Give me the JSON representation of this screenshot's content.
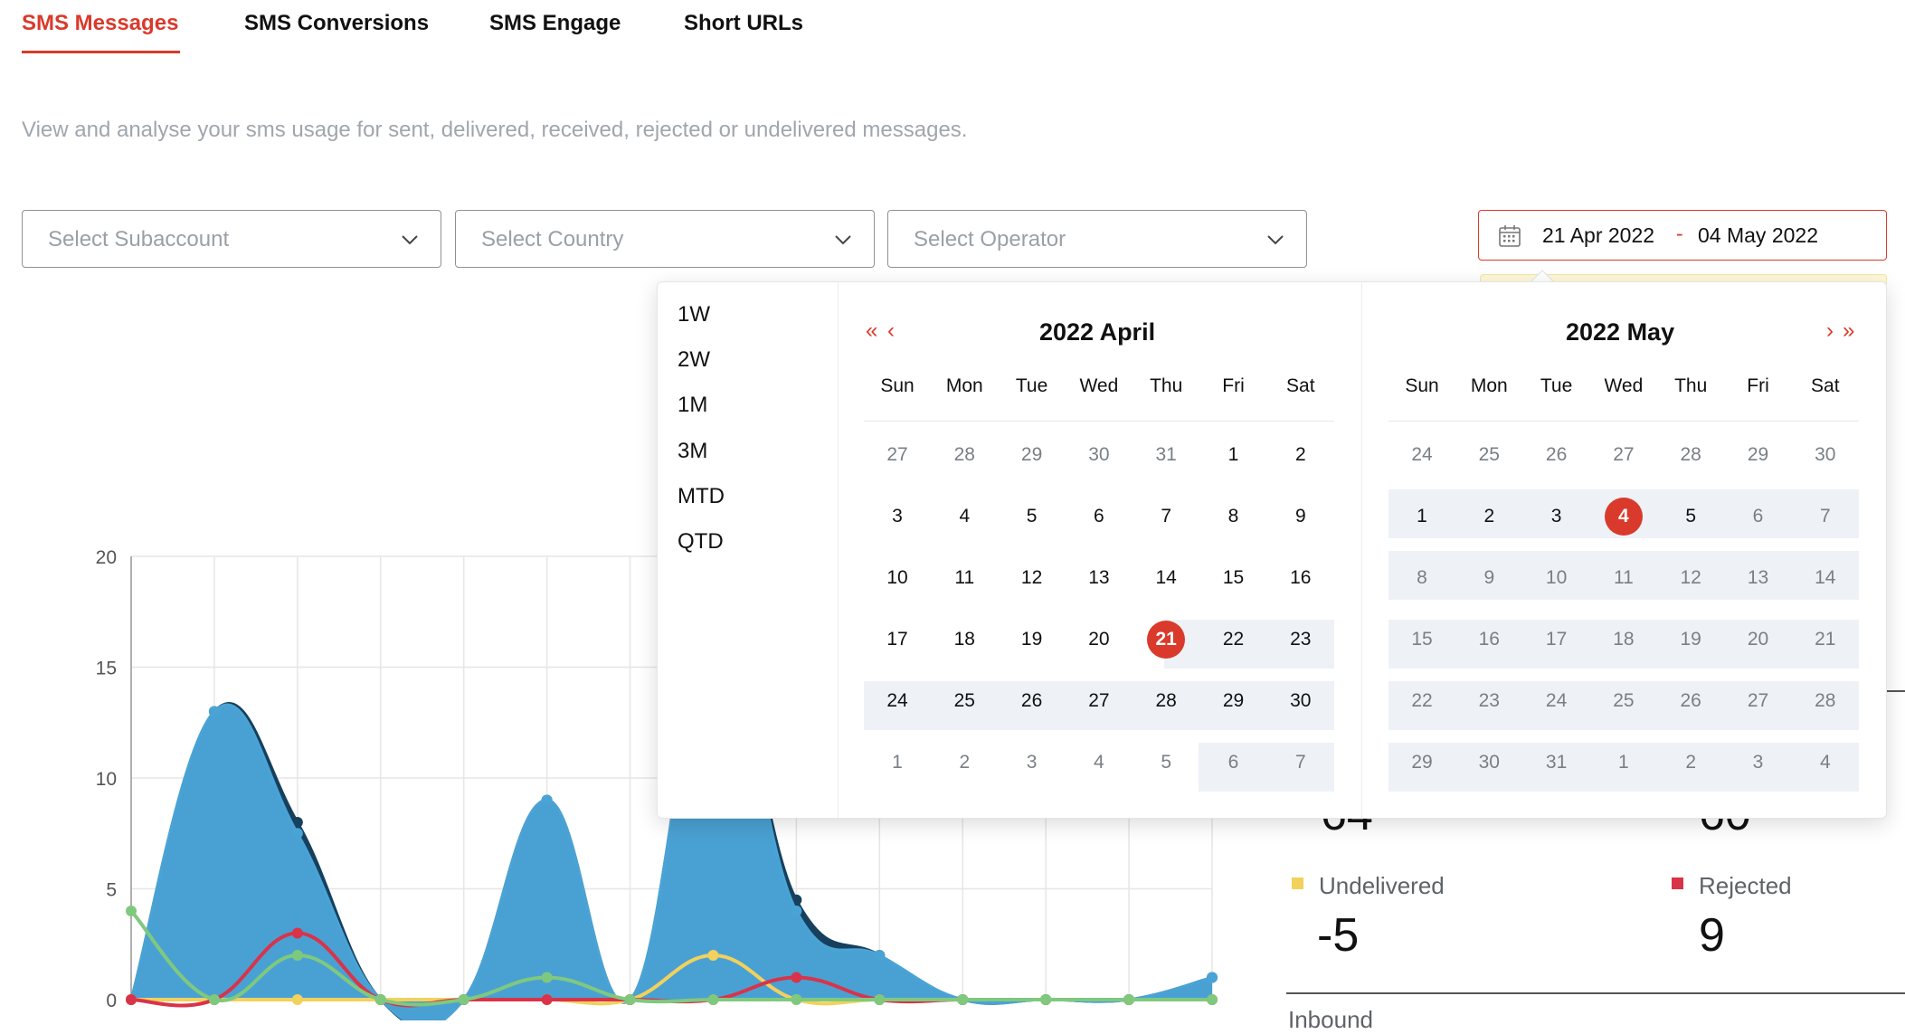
{
  "tabs": [
    {
      "label": "SMS Messages",
      "active": true
    },
    {
      "label": "SMS Conversions",
      "active": false
    },
    {
      "label": "SMS Engage",
      "active": false
    },
    {
      "label": "Short URLs",
      "active": false
    }
  ],
  "subtitle": "View and analyse your sms usage for sent, delivered, received, rejected or undelivered messages.",
  "filters": {
    "subaccount_placeholder": "Select Subaccount",
    "country_placeholder": "Select Country",
    "operator_placeholder": "Select Operator"
  },
  "date_range": {
    "start": "21 Apr 2022",
    "separator": "-",
    "end": "04 May 2022"
  },
  "picker": {
    "presets": [
      "1W",
      "2W",
      "1M",
      "3M",
      "MTD",
      "QTD"
    ],
    "weekdays": [
      "Sun",
      "Mon",
      "Tue",
      "Wed",
      "Thu",
      "Fri",
      "Sat"
    ],
    "left": {
      "title": "2022 April",
      "nav_prev_year": "«",
      "nav_prev_month": "‹",
      "weeks": [
        [
          "27",
          "28",
          "29",
          "30",
          "31",
          "1",
          "2"
        ],
        [
          "3",
          "4",
          "5",
          "6",
          "7",
          "8",
          "9"
        ],
        [
          "10",
          "11",
          "12",
          "13",
          "14",
          "15",
          "16"
        ],
        [
          "17",
          "18",
          "19",
          "20",
          "21",
          "22",
          "23"
        ],
        [
          "24",
          "25",
          "26",
          "27",
          "28",
          "29",
          "30"
        ],
        [
          "1",
          "2",
          "3",
          "4",
          "5",
          "6",
          "7"
        ]
      ]
    },
    "right": {
      "title": "2022 May",
      "nav_next_month": "›",
      "nav_next_year": "»",
      "weeks": [
        [
          "24",
          "25",
          "26",
          "27",
          "28",
          "29",
          "30"
        ],
        [
          "1",
          "2",
          "3",
          "4",
          "5",
          "6",
          "7"
        ],
        [
          "8",
          "9",
          "10",
          "11",
          "12",
          "13",
          "14"
        ],
        [
          "15",
          "16",
          "17",
          "18",
          "19",
          "20",
          "21"
        ],
        [
          "22",
          "23",
          "24",
          "25",
          "26",
          "27",
          "28"
        ],
        [
          "29",
          "30",
          "31",
          "1",
          "2",
          "3",
          "4"
        ]
      ]
    },
    "selected_start": "21",
    "selected_end": "4"
  },
  "stats": {
    "left_partial_value": "64",
    "right_partial_value": "60",
    "undelivered": {
      "label": "Undelivered",
      "value": "-5",
      "color": "#f2d15c"
    },
    "rejected": {
      "label": "Rejected",
      "value": "9",
      "color": "#d9334a"
    },
    "inbound_label": "Inbound"
  },
  "colors": {
    "accent": "#d93a2b",
    "area_blue": "#4aa3d5",
    "area_dark": "#16405e",
    "green": "#7fc97f",
    "red": "#d9334a",
    "yellow": "#f2d15c"
  },
  "chart_data": {
    "type": "area",
    "y_ticks": [
      "0",
      "5",
      "10",
      "15",
      "20"
    ],
    "ylim": [
      0,
      20
    ],
    "x": [
      0,
      1,
      2,
      3,
      4,
      5,
      6,
      7,
      8,
      9,
      10,
      11,
      12,
      13
    ],
    "series": [
      {
        "color": "#16405e",
        "values": [
          0,
          13,
          8,
          0,
          0,
          9,
          0,
          16,
          4.5,
          2,
          0,
          0,
          0,
          1
        ]
      },
      {
        "color": "#4aa3d5",
        "values": [
          0,
          13,
          7.5,
          0,
          0,
          9,
          0,
          16,
          4,
          2,
          0,
          0,
          0,
          1
        ]
      },
      {
        "color": "#f2d15c",
        "values": [
          0,
          0,
          0,
          0,
          0,
          0,
          0,
          2,
          0,
          0,
          0,
          0,
          0,
          0
        ]
      },
      {
        "color": "#d9334a",
        "values": [
          0,
          0,
          3,
          0,
          0,
          0,
          0,
          0,
          1,
          0,
          0,
          0,
          0,
          0
        ]
      },
      {
        "color": "#7fc97f",
        "values": [
          4,
          0,
          2,
          0,
          0,
          1,
          0,
          0,
          0,
          0,
          0,
          0,
          0,
          0
        ]
      }
    ]
  }
}
